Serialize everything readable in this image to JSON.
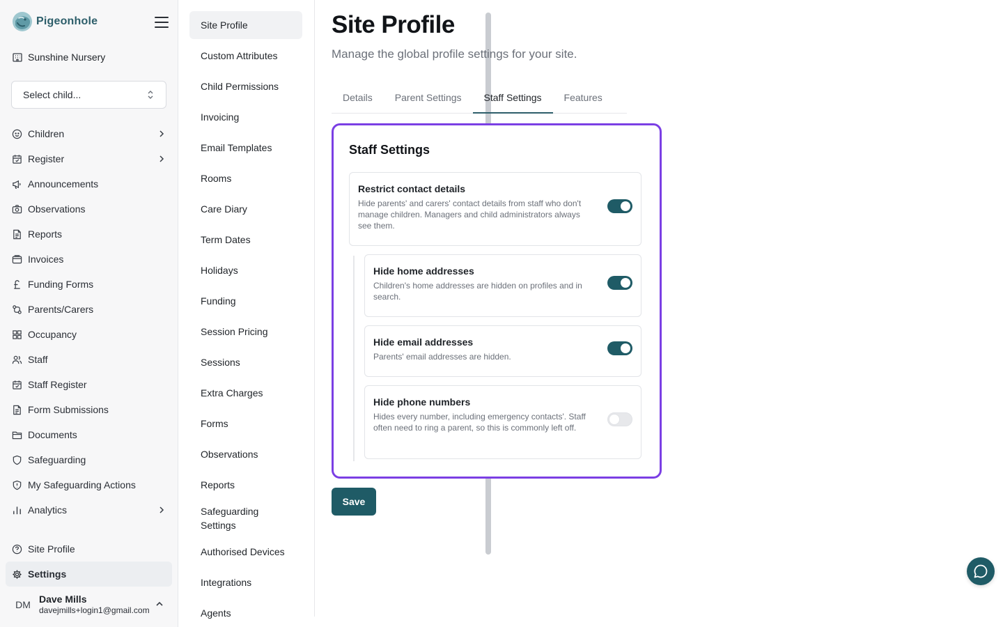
{
  "brand": {
    "name": "Pigeonhole"
  },
  "site": {
    "name": "Sunshine Nursery"
  },
  "child_select": {
    "label": "Select child..."
  },
  "nav": {
    "items": [
      {
        "label": "Children",
        "icon": "child-icon"
      },
      {
        "label": "Register",
        "icon": "calendar-check-icon"
      },
      {
        "label": "Announcements",
        "icon": "megaphone-icon"
      },
      {
        "label": "Observations",
        "icon": "camera-icon"
      },
      {
        "label": "Reports",
        "icon": "document-icon"
      },
      {
        "label": "Invoices",
        "icon": "wallet-icon"
      },
      {
        "label": "Funding Forms",
        "icon": "pound-icon"
      },
      {
        "label": "Parents/Carers",
        "icon": "link-icon"
      },
      {
        "label": "Occupancy",
        "icon": "grid-icon"
      },
      {
        "label": "Staff",
        "icon": "users-icon"
      },
      {
        "label": "Staff Register",
        "icon": "calendar-check-icon"
      },
      {
        "label": "Form Submissions",
        "icon": "document-icon"
      },
      {
        "label": "Documents",
        "icon": "folder-icon"
      },
      {
        "label": "Safeguarding",
        "icon": "shield-icon"
      },
      {
        "label": "My Safeguarding Actions",
        "icon": "shield-alert-icon"
      },
      {
        "label": "Analytics",
        "icon": "bar-chart-icon"
      }
    ],
    "bottom": [
      {
        "label": "Site Profile",
        "icon": "help-circle-icon"
      },
      {
        "label": "Settings",
        "icon": "gear-icon"
      }
    ]
  },
  "user": {
    "initials": "DM",
    "name": "Dave Mills",
    "email": "davejmills+login1@gmail.com"
  },
  "subnav": {
    "items": [
      "Site Profile",
      "Custom Attributes",
      "Child Permissions",
      "Invoicing",
      "Email Templates",
      "Rooms",
      "Care Diary",
      "Term Dates",
      "Holidays",
      "Funding",
      "Session Pricing",
      "Sessions",
      "Extra Charges",
      "Forms",
      "Observations",
      "Reports",
      "Safeguarding Settings",
      "Authorised Devices",
      "Integrations",
      "Agents"
    ]
  },
  "page": {
    "title": "Site Profile",
    "subtitle": "Manage the global profile settings for your site."
  },
  "tabs": [
    "Details",
    "Parent Settings",
    "Staff Settings",
    "Features"
  ],
  "card": {
    "title": "Staff Settings",
    "settings": [
      {
        "title": "Restrict contact details",
        "desc": "Hide parents' and carers' contact details from staff who don't manage children. Managers and child administrators always see them.",
        "enabled": true
      },
      {
        "title": "Hide home addresses",
        "desc": "Children's home addresses are hidden on profiles and in search.",
        "enabled": true
      },
      {
        "title": "Hide email addresses",
        "desc": "Parents' email addresses are hidden.",
        "enabled": true
      },
      {
        "title": "Hide phone numbers",
        "desc": "Hides every number, including emergency contacts'. Staff often need to ring a parent, so this is commonly left off.",
        "enabled": false
      }
    ]
  },
  "actions": {
    "save_label": "Save"
  },
  "colors": {
    "accent": "#1f5b66",
    "highlight": "#7b3fe4",
    "brand_text": "#2d5e6a"
  }
}
